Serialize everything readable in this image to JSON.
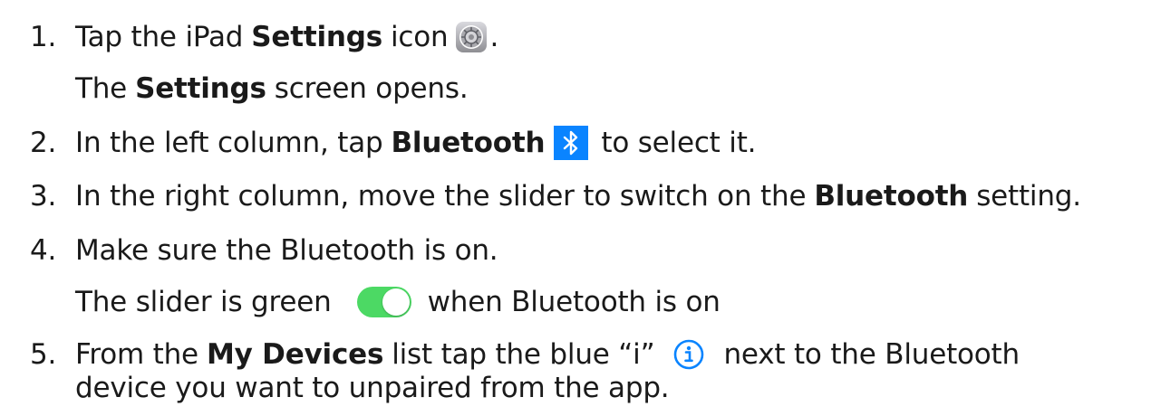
{
  "steps": [
    {
      "number": "1.",
      "before": "Tap the iPad",
      "bold": "Settings",
      "after": "icon",
      "end": ".",
      "icon": "settings-gear-icon"
    },
    {
      "before": "The",
      "bold": "Settings",
      "after": "screen opens."
    },
    {
      "number": "2.",
      "before": "In the left column, tap",
      "bold": "Bluetooth",
      "after": "to select it.",
      "icon": "bluetooth-icon",
      "icon_color": "#0A84FF"
    },
    {
      "number": "3.",
      "before": "In the right column, move the slider to switch on the",
      "bold": "Bluetooth",
      "after": "setting."
    },
    {
      "number": "4.",
      "text": "Make sure the Bluetooth is on."
    },
    {
      "before": "The slider is green",
      "after": "when Bluetooth is on",
      "icon": "toggle-switch-on-icon",
      "icon_color": "#4CD964"
    },
    {
      "number": "5.",
      "before": "From the",
      "bold": "My Devices",
      "after1": "list tap the blue “i”",
      "after2": "next to the Bluetooth",
      "icon": "info-circle-icon",
      "icon_color": "#0A84FF"
    },
    {
      "text": "device you want to unpaired from the app."
    }
  ]
}
